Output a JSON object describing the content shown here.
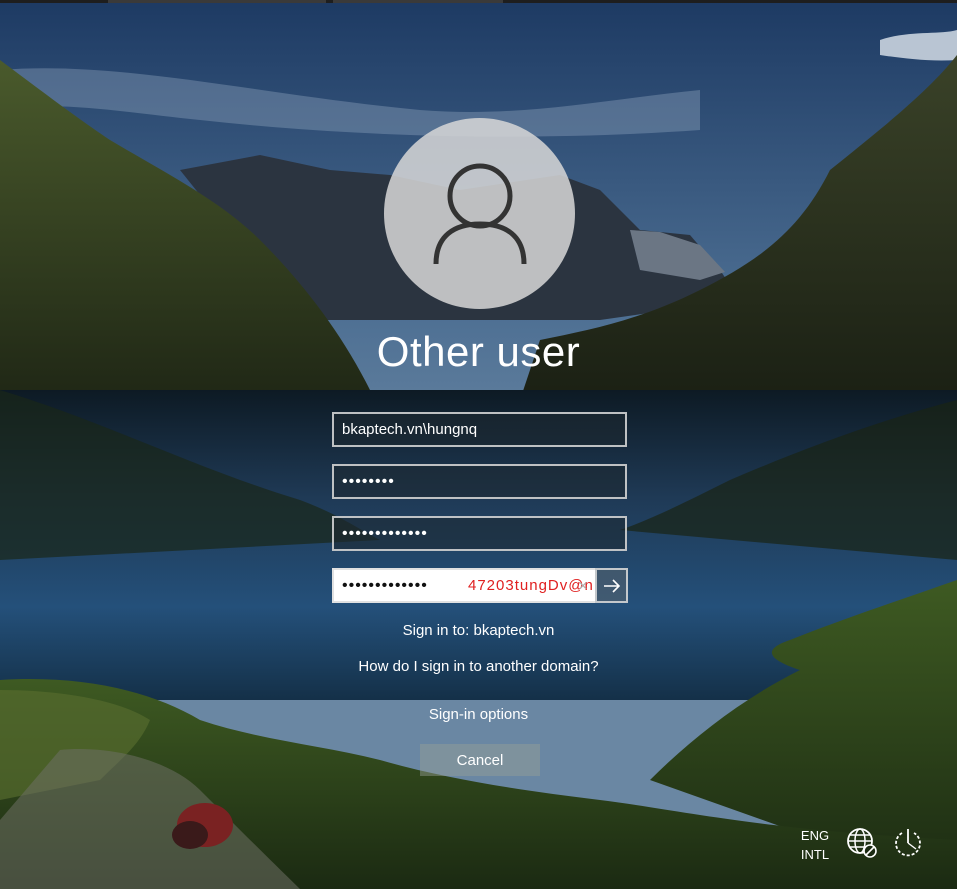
{
  "user": {
    "display_name": "Other user"
  },
  "fields": {
    "username": {
      "value": "bkaptech.vn\\hungnq"
    },
    "password": {
      "value": "••••••••"
    },
    "new_password": {
      "value": "•••••••••••••"
    },
    "confirm_password": {
      "value": "•••••••••••••",
      "overlay_text": "47203tungDv@n"
    }
  },
  "links": {
    "sign_in_to": "Sign in to: bkaptech.vn",
    "another_domain": "How do I sign in to another domain?",
    "sign_in_options": "Sign-in options"
  },
  "buttons": {
    "cancel": "Cancel"
  },
  "system": {
    "lang_line1": "ENG",
    "lang_line2": "INTL"
  },
  "icons": {
    "avatar": "user-silhouette-icon",
    "submit": "arrow-right-icon",
    "network": "globe-network-icon",
    "power": "power-icon",
    "clear": "close-icon"
  },
  "colors": {
    "overlay_text": "#e02020",
    "field_border": "#dcdcdc"
  }
}
